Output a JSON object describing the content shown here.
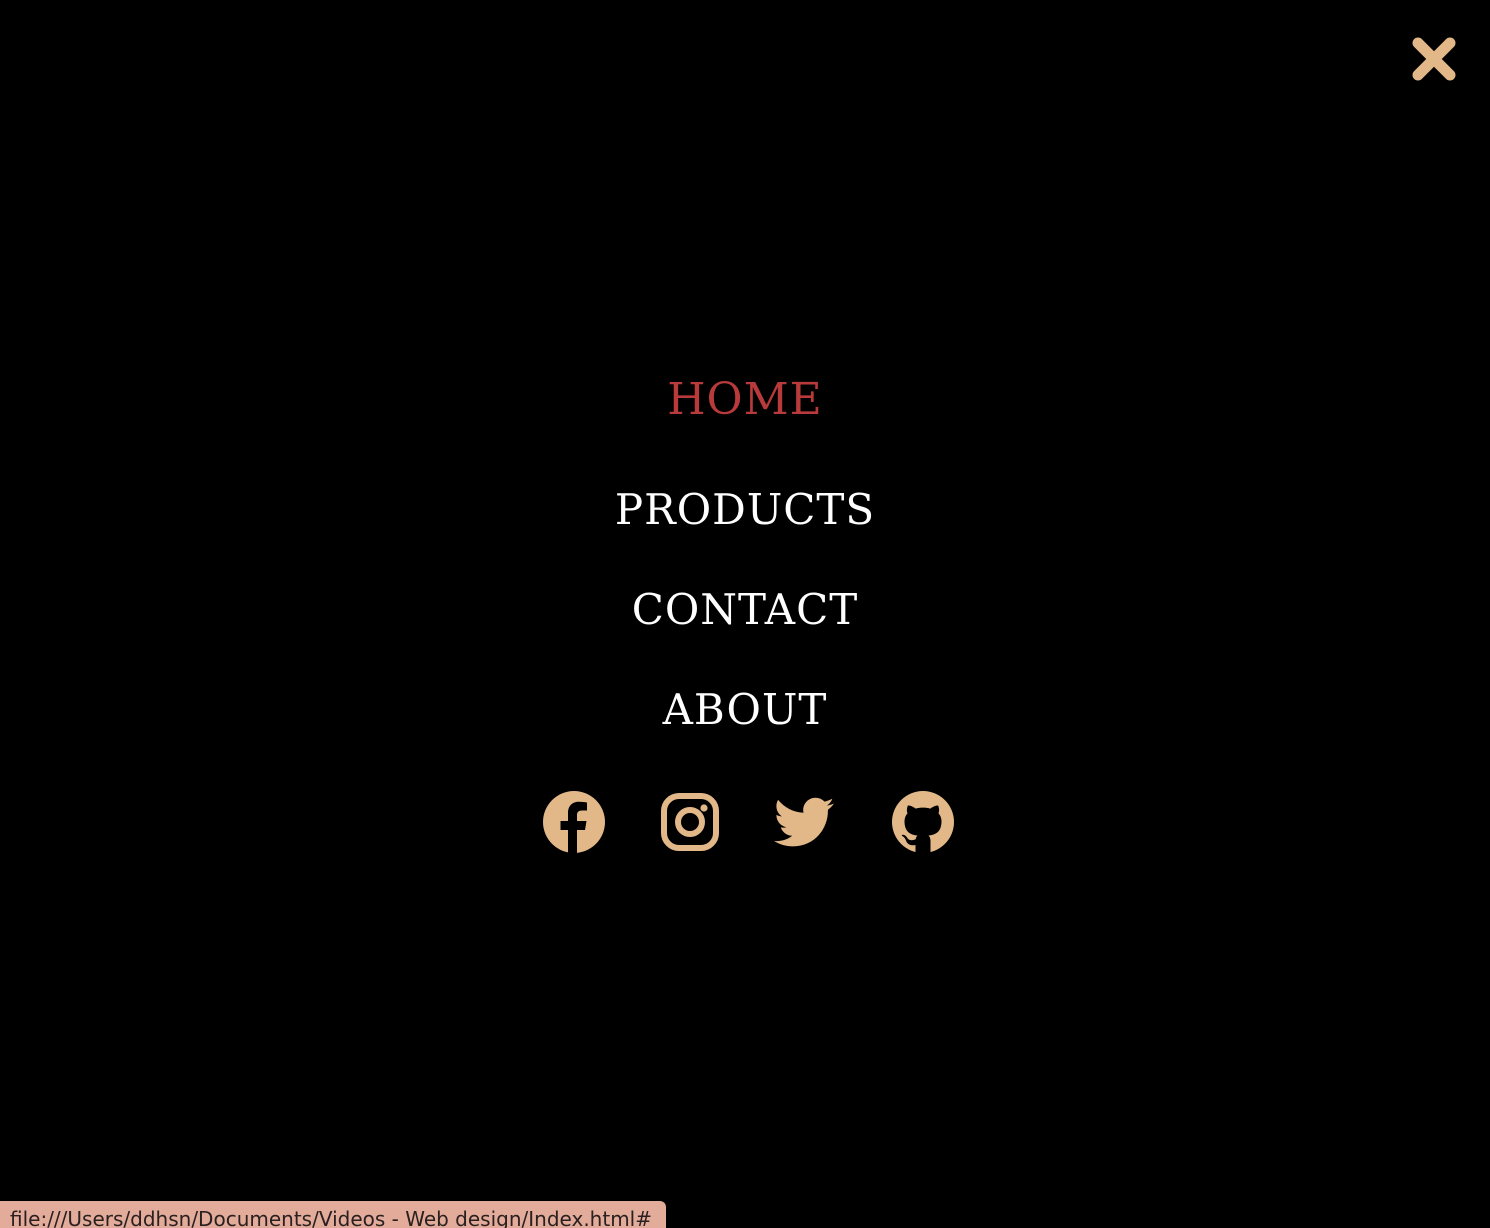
{
  "close": {
    "icon": "close-x-icon"
  },
  "nav": {
    "items": [
      {
        "label": "HOME",
        "active": true
      },
      {
        "label": "PRODUCTS",
        "active": false
      },
      {
        "label": "CONTACT",
        "active": false
      },
      {
        "label": "ABOUT",
        "active": false
      }
    ]
  },
  "social": [
    {
      "icon": "facebook-icon"
    },
    {
      "icon": "instagram-icon"
    },
    {
      "icon": "twitter-icon"
    },
    {
      "icon": "github-icon"
    }
  ],
  "status_bar": {
    "url": "file:///Users/ddhsn/Documents/Videos - Web design/Index.html#"
  },
  "colors": {
    "background": "#000000",
    "accent": "#e2b888",
    "active_nav": "#b83a3a",
    "nav_text": "#ffffff",
    "status_bar_bg": "#e2ab9a"
  }
}
